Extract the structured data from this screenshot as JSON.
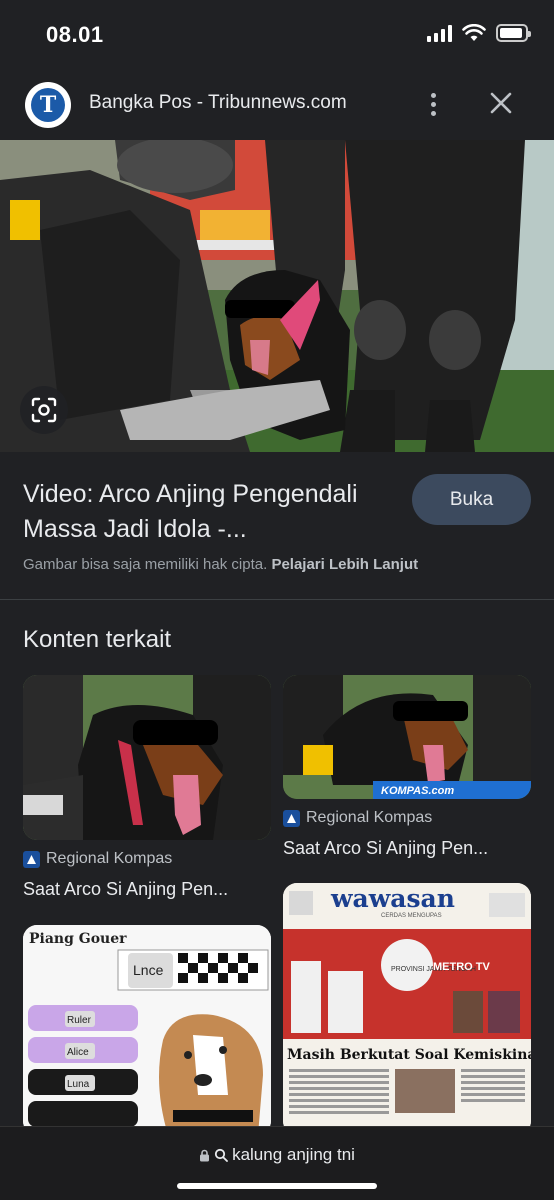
{
  "status_bar": {
    "time": "08.01"
  },
  "header": {
    "logo_letter": "T",
    "site_name": "Bangka Pos - Tribunnews.com",
    "more_icon": "more-vert-icon",
    "close_icon": "close-icon"
  },
  "result": {
    "title": "Video: Arco Anjing Pengendali Massa Jadi Idola -...",
    "open_label": "Buka",
    "copyright_text": "Gambar bisa saja memiliki hak cipta.",
    "learn_more": "Pelajari Lebih Lanjut",
    "lens_icon": "lens-icon"
  },
  "related": {
    "heading": "Konten terkait",
    "cards": [
      {
        "source": "Regional Kompas",
        "title": "Saat Arco Si Anjing Pen..."
      },
      {
        "source": "Regional Kompas",
        "title": "Saat Arco Si Anjing Pen...",
        "watermark": "KOMPAS.com"
      },
      {
        "brand": "Piang Gouer",
        "tags": [
          "Lnce",
          "Ruler",
          "Alice",
          "Luna"
        ]
      },
      {
        "masthead": "wawasan",
        "tagline": "CERDAS MENGUPAS",
        "headline": "Masih Berkutat Soal Kemiskinan",
        "channel": "METRO TV",
        "region": "PROVINSI JAWA TENGAH"
      }
    ]
  },
  "bottom_bar": {
    "query": "kalung anjing tni"
  }
}
